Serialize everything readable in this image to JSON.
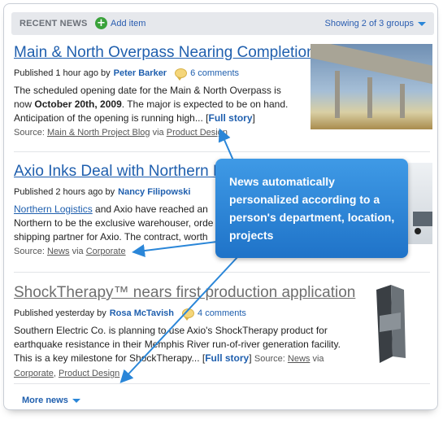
{
  "header": {
    "title": "RECENT NEWS",
    "add_label": "Add item",
    "groups_label": "Showing 2 of 3 groups"
  },
  "articles": [
    {
      "title": "Main & North Overpass Nearing Completion",
      "published": "Published 1 hour ago by",
      "author": "Peter Barker",
      "comments": "6 comments",
      "body_pre": "The scheduled opening date for the Main & North Overpass is now",
      "body_bold": "October 20th, 2009",
      "body_post": ". The major is expected to be on hand. Anticipation of the opening is running high...",
      "full_story": "Full story",
      "source_label": "Source:",
      "source": "Main & North Project Blog",
      "via": "via",
      "via_source": "Product Design"
    },
    {
      "title": "Axio Inks Deal with Northern L",
      "published": "Published 2 hours ago by",
      "author": "Nancy Filipowski",
      "body_link": "Northern Logistics",
      "body_line1": " and Axio have reached an",
      "body_line2": "Northern to be the exclusive warehouser, orde",
      "body_line3": "shipping partner for Axio. The contract, worth",
      "source_label": "Source:",
      "source": "News",
      "via": "via",
      "via_source": "Corporate"
    },
    {
      "title": "ShockTherapy™ nears first production application",
      "published": "Published yesterday by",
      "author": "Rosa McTavish",
      "comments": "4 comments",
      "body": "Southern Electric Co. is planning to use Axio's ShockTherapy product for earthquake resistance in their Memphis River run-of-river generation facility. This is a key milestone for ShockTherapy...",
      "full_story": "Full story",
      "source_label": "Source:",
      "source": "News",
      "via": "via",
      "via_source1": "Corporate",
      "via_source2": "Product Design"
    }
  ],
  "more_label": "More news",
  "callout_text": "News automatically personalized according to a person's department, location, projects",
  "icons": [
    "plus-icon",
    "caret-down-icon",
    "comment-bubble-icon"
  ],
  "colors": {
    "link": "#1f5fae",
    "callout": "#2a86d8",
    "add": "#3aa23a"
  }
}
